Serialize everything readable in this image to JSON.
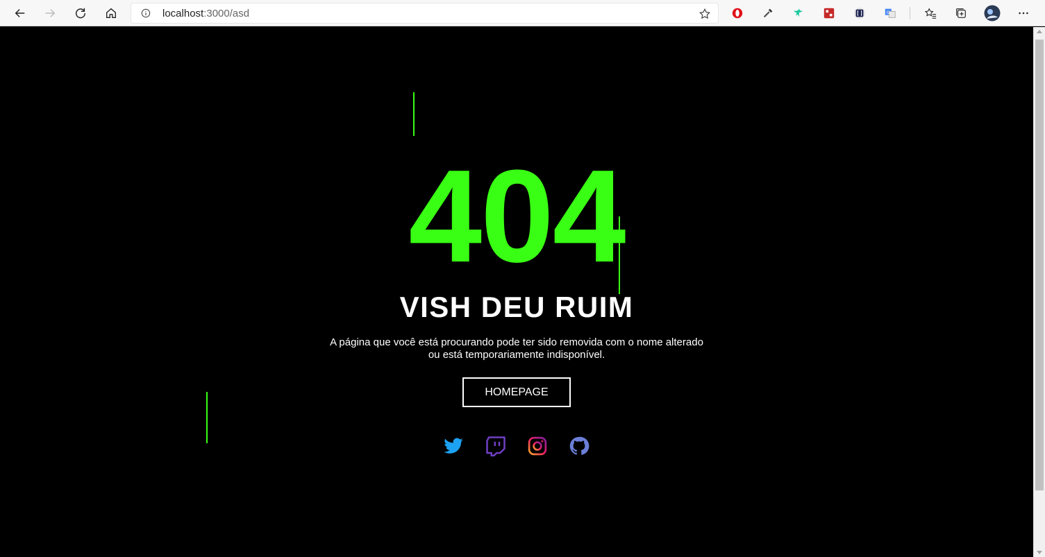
{
  "browser": {
    "url_host": "localhost",
    "url_path": ":3000/asd",
    "icons": [
      "back-icon",
      "forward-icon",
      "refresh-icon",
      "home-icon",
      "info-icon",
      "star-icon",
      "opera-icon",
      "eyedropper-icon",
      "extension-bird-icon",
      "extension-red-icon",
      "extension-bracket-icon",
      "translate-icon",
      "favorites-icon",
      "collections-icon",
      "profile-avatar",
      "more-icon"
    ]
  },
  "page": {
    "error_code": "404",
    "headline": "VISH DEU RUIM",
    "description": "A página que você está procurando pode ter sido removida com o nome alterado ou está temporariamente indisponível.",
    "button_label": "HOMEPAGE",
    "accent_color": "#39ff14",
    "social": [
      "twitter-icon",
      "twitch-icon",
      "instagram-icon",
      "github-icon"
    ]
  }
}
